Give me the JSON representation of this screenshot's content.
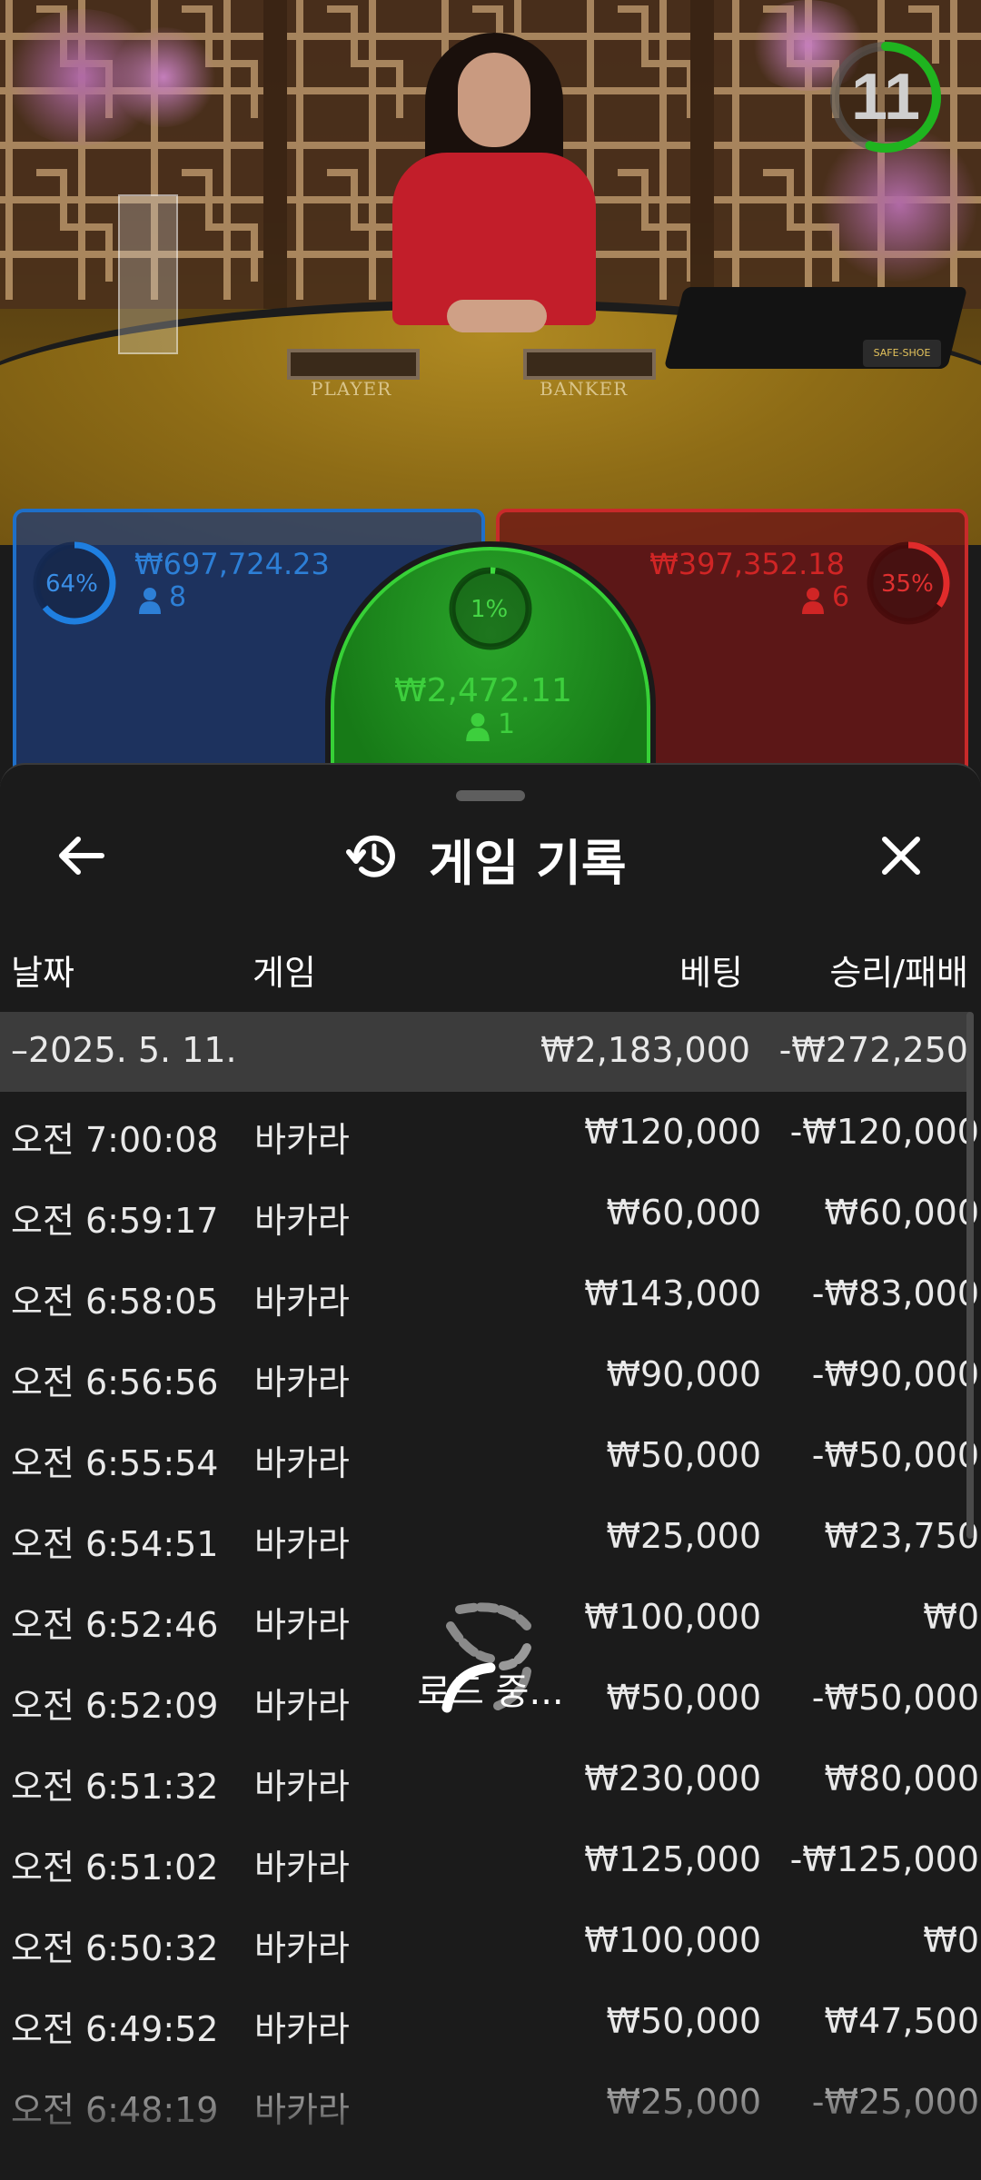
{
  "video": {
    "table_labels": {
      "player": "PLAYER",
      "banker": "BANKER"
    },
    "shoe_brand": "SAFE-SHOE",
    "countdown": "11",
    "countdown_remaining_fraction": 0.55
  },
  "bets": {
    "player": {
      "percent": "64%",
      "percent_value": 0.64,
      "amount": "₩697,724.23",
      "players": "8",
      "color": "#1f6fc8"
    },
    "tie": {
      "percent": "1%",
      "percent_value": 0.01,
      "amount": "₩2,472.11",
      "players": "1",
      "color": "#37d137"
    },
    "banker": {
      "percent": "35%",
      "percent_value": 0.35,
      "amount": "₩397,352.18",
      "players": "6",
      "color": "#e02b2b"
    }
  },
  "history": {
    "title": "게임 기록",
    "icons": {
      "back": "arrow-left-icon",
      "history": "history-icon",
      "close": "close-icon"
    },
    "columns": {
      "date": "날짜",
      "game": "게임",
      "bet": "베팅",
      "result": "승리/패배"
    },
    "summary": {
      "date": "–2025. 5. 11.",
      "bet": "₩2,183,000",
      "result": "-₩272,250"
    },
    "rows": [
      {
        "time": "오전 7:00:08",
        "game": "바카라",
        "bet": "₩120,000",
        "result": "-₩120,000"
      },
      {
        "time": "오전 6:59:17",
        "game": "바카라",
        "bet": "₩60,000",
        "result": "₩60,000"
      },
      {
        "time": "오전 6:58:05",
        "game": "바카라",
        "bet": "₩143,000",
        "result": "-₩83,000"
      },
      {
        "time": "오전 6:56:56",
        "game": "바카라",
        "bet": "₩90,000",
        "result": "-₩90,000"
      },
      {
        "time": "오전 6:55:54",
        "game": "바카라",
        "bet": "₩50,000",
        "result": "-₩50,000"
      },
      {
        "time": "오전 6:54:51",
        "game": "바카라",
        "bet": "₩25,000",
        "result": "₩23,750"
      },
      {
        "time": "오전 6:52:46",
        "game": "바카라",
        "bet": "₩100,000",
        "result": "₩0"
      },
      {
        "time": "오전 6:52:09",
        "game": "바카라",
        "bet": "₩50,000",
        "result": "-₩50,000"
      },
      {
        "time": "오전 6:51:32",
        "game": "바카라",
        "bet": "₩230,000",
        "result": "₩80,000"
      },
      {
        "time": "오전 6:51:02",
        "game": "바카라",
        "bet": "₩125,000",
        "result": "-₩125,000"
      },
      {
        "time": "오전 6:50:32",
        "game": "바카라",
        "bet": "₩100,000",
        "result": "₩0"
      },
      {
        "time": "오전 6:49:52",
        "game": "바카라",
        "bet": "₩50,000",
        "result": "₩47,500"
      },
      {
        "time": "오전 6:48:19",
        "game": "바카라",
        "bet": "₩25,000",
        "result": "-₩25,000"
      }
    ],
    "loading_text": "로드 중..."
  }
}
